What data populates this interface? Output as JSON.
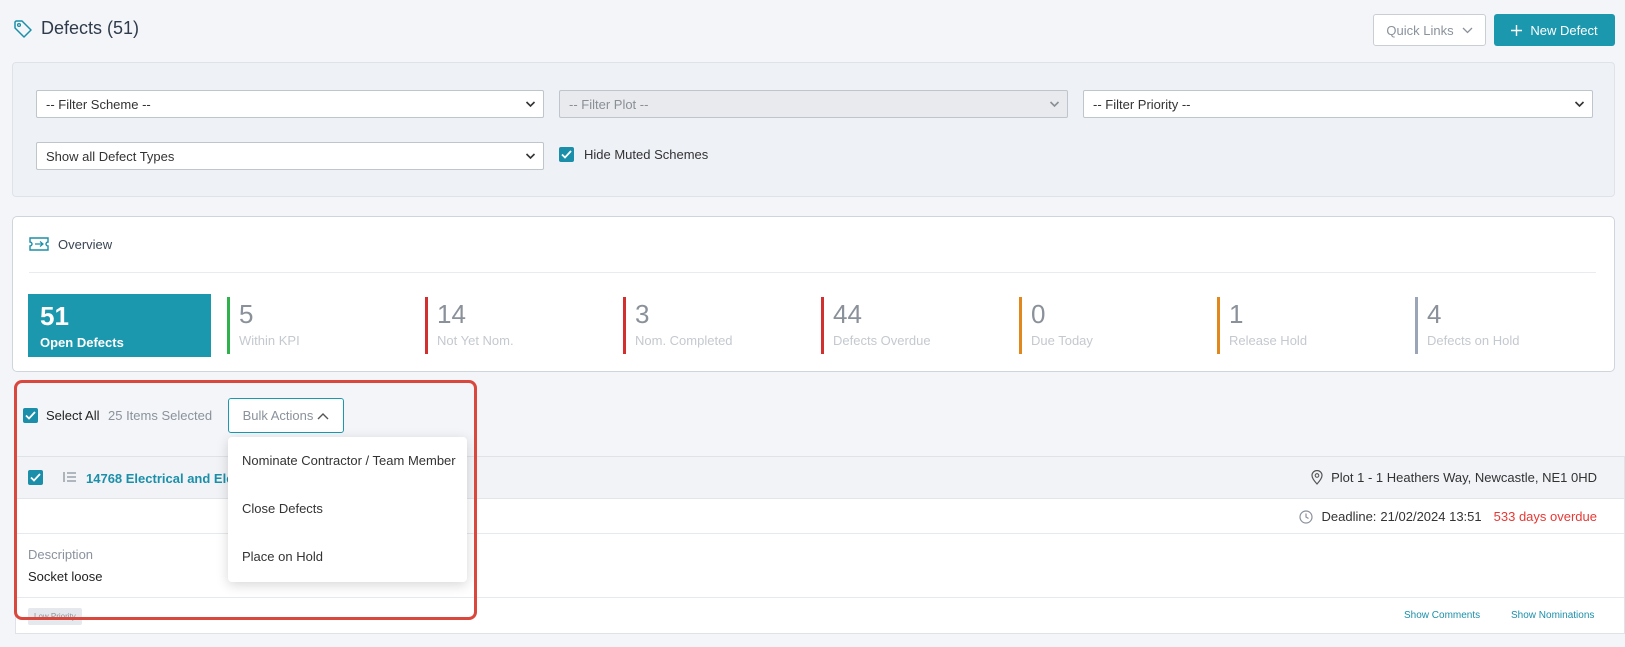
{
  "header": {
    "title": "Defects (51)",
    "quick_links_label": "Quick Links",
    "new_defect_label": "New Defect"
  },
  "filters": {
    "scheme": "-- Filter Scheme --",
    "plot": "-- Filter Plot --",
    "priority": "-- Filter Priority --",
    "defect_types": "Show all Defect Types",
    "hide_muted_label": "Hide Muted Schemes",
    "hide_muted_checked": true
  },
  "overview": {
    "title": "Overview",
    "open": {
      "value": "51",
      "label": "Open Defects"
    },
    "stats": [
      {
        "value": "5",
        "label": "Within KPI",
        "color": "#2fb24c"
      },
      {
        "value": "14",
        "label": "Not Yet Nom.",
        "color": "#d22f2f"
      },
      {
        "value": "3",
        "label": "Nom. Completed",
        "color": "#d22f2f"
      },
      {
        "value": "44",
        "label": "Defects Overdue",
        "color": "#d22f2f"
      },
      {
        "value": "0",
        "label": "Due Today",
        "color": "#e2871b"
      },
      {
        "value": "1",
        "label": "Release Hold",
        "color": "#e2871b"
      },
      {
        "value": "4",
        "label": "Defects on Hold",
        "color": "#9aa6b6"
      }
    ]
  },
  "bulk": {
    "select_all_label": "Select All",
    "selected_count": "25 Items Selected",
    "bulk_actions_label": "Bulk Actions",
    "menu": [
      "Nominate Contractor / Team Member",
      "Close Defects",
      "Place on Hold"
    ]
  },
  "defect": {
    "title": "14768 Electrical and Elec",
    "location": "Plot 1 - 1 Heathers Way, Newcastle, NE1 0HD",
    "deadline_label": "Deadline:",
    "deadline_value": "21/02/2024 13:51",
    "overdue": "533 days overdue",
    "description_label": "Description",
    "description": "Socket loose",
    "priority_badge": "Low Priority",
    "show_comments": "Show Comments",
    "show_nominations": "Show Nominations"
  },
  "colors": {
    "accent": "#1b98ae",
    "highlight": "#d9473d",
    "overdue": "#e53935"
  }
}
